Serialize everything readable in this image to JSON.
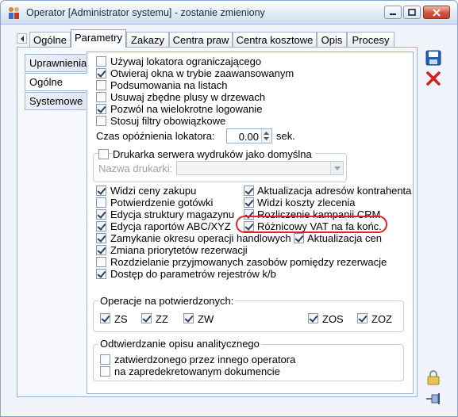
{
  "window": {
    "title": "Operator [Administrator systemu] - zostanie zmieniony"
  },
  "tabs": [
    {
      "label": "Ogólne"
    },
    {
      "label": "Parametry"
    },
    {
      "label": "Zakazy"
    },
    {
      "label": "Centra praw"
    },
    {
      "label": "Centra kosztowe"
    },
    {
      "label": "Opis"
    },
    {
      "label": "Procesy"
    }
  ],
  "side_tabs": [
    {
      "label": "Uprawnienia"
    },
    {
      "label": "Ogólne"
    },
    {
      "label": "Systemowe"
    }
  ],
  "options_top": [
    {
      "label": "Używaj lokatora ograniczającego",
      "checked": false
    },
    {
      "label": "Otwieraj okna w trybie zaawansowanym",
      "checked": true
    },
    {
      "label": "Podsumowania na listach",
      "checked": false
    },
    {
      "label": "Usuwaj zbędne plusy w drzewach",
      "checked": false
    },
    {
      "label": "Pozwól na wielokrotne logowanie",
      "checked": true
    },
    {
      "label": "Stosuj filtry obowiązkowe",
      "checked": false
    }
  ],
  "locator_delay": {
    "label": "Czas opóźnienia lokatora:",
    "value": "0.00",
    "unit": "sek."
  },
  "printer": {
    "checkbox_label": "Drukarka serwera wydruków jako domyślna",
    "checked": false,
    "name_label": "Nazwa drukarki:",
    "name_value": ""
  },
  "options_left": [
    {
      "label": "Widzi ceny zakupu",
      "checked": true
    },
    {
      "label": "Potwierdzenie gotówki",
      "checked": false
    },
    {
      "label": "Edycja struktury magazynu",
      "checked": true
    },
    {
      "label": "Edycja raportów ABC/XYZ",
      "checked": true
    },
    {
      "label": "Zamykanie okresu operacji handlowych",
      "checked": true
    },
    {
      "label": "Zmiana priorytetów rezerwacji",
      "checked": true
    },
    {
      "label": "Rozdzielanie przyjmowanych zasobów pomiędzy rezerwacje",
      "checked": false
    },
    {
      "label": "Dostęp do parametrów rejestrów k/b",
      "checked": true
    }
  ],
  "options_right": [
    {
      "label": "Aktualizacja adresów kontrahenta",
      "checked": true
    },
    {
      "label": "Widzi koszty zlecenia",
      "checked": true
    },
    {
      "label": "Rozliczenie kampanii CRM",
      "checked": true
    },
    {
      "label": "Różnicowy VAT na fa końc.",
      "checked": true
    },
    {
      "label": "Aktualizacja cen",
      "checked": true
    }
  ],
  "confirmed_ops": {
    "title": "Operacje na potwierdzonych:",
    "items": [
      {
        "label": "ZS",
        "checked": true
      },
      {
        "label": "ZZ",
        "checked": true
      },
      {
        "label": "ZW",
        "checked": true
      },
      {
        "label": "ZOS",
        "checked": true
      },
      {
        "label": "ZOZ",
        "checked": true
      }
    ]
  },
  "analytic": {
    "title": "Odtwierdzanie opisu analitycznego",
    "items": [
      {
        "label": "zatwierdzonego przez innego operatora",
        "checked": false
      },
      {
        "label": "na zapredekretowanym dokumencie",
        "checked": false
      }
    ]
  },
  "colors": {
    "accent": "#2c3f66",
    "highlight": "#e0232a",
    "save": "#1f5fb8",
    "cancel": "#d42020"
  }
}
